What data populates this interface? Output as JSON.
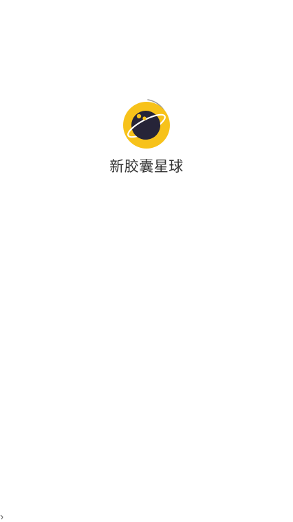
{
  "splash": {
    "app_name": "新胶囊星球",
    "logo_icon": "planet-logo-icon",
    "colors": {
      "background": "#ffffff",
      "logo_ring": "#f7c21a",
      "planet": "#262438",
      "planet_eyes": "#f7c21a",
      "orbit": "#ffffff",
      "loading_arc": "#9a9a9a",
      "app_name_text": "#333333"
    }
  }
}
